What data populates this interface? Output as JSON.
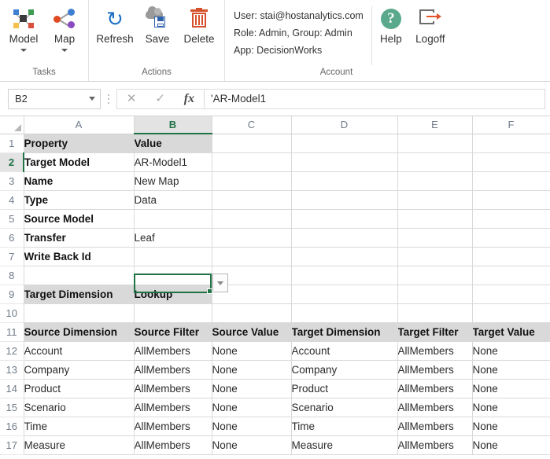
{
  "ribbon": {
    "groups": [
      {
        "label": "Tasks",
        "buttons": [
          {
            "label": "Model",
            "icon": "model-icon",
            "has_caret": true
          },
          {
            "label": "Map",
            "icon": "map-icon",
            "has_caret": true
          }
        ]
      },
      {
        "label": "Actions",
        "buttons": [
          {
            "label": "Refresh",
            "icon": "refresh-icon",
            "has_caret": false
          },
          {
            "label": "Save",
            "icon": "save-cloud-icon",
            "has_caret": false
          },
          {
            "label": "Delete",
            "icon": "trash-icon",
            "has_caret": false
          }
        ]
      },
      {
        "label": "Account",
        "info": [
          "User: stai@hostanalytics.com",
          "Role: Admin, Group: Admin",
          "App: DecisionWorks"
        ],
        "buttons": [
          {
            "label": "Help",
            "icon": "help-icon",
            "has_caret": false
          },
          {
            "label": "Logoff",
            "icon": "logoff-icon",
            "has_caret": false
          }
        ]
      }
    ]
  },
  "formula_bar": {
    "name_box_value": "B2",
    "cancel_icon": "✕",
    "accept_icon": "✓",
    "function_icon": "fx",
    "formula_value": "'AR-Model1"
  },
  "sheet": {
    "columns": [
      "A",
      "B",
      "C",
      "D",
      "E",
      "F"
    ],
    "selected_column": "B",
    "selected_row": "2",
    "selected_cell_value": "AR-Model1",
    "rows": [
      {
        "num": "1",
        "style": "header",
        "cells": [
          "Property",
          "Value",
          "",
          "",
          "",
          ""
        ]
      },
      {
        "num": "2",
        "style": "bold",
        "cells": [
          "Target Model",
          "AR-Model1",
          "",
          "",
          "",
          ""
        ]
      },
      {
        "num": "3",
        "style": "bold",
        "cells": [
          "Name",
          "New Map",
          "",
          "",
          "",
          ""
        ]
      },
      {
        "num": "4",
        "style": "bold",
        "cells": [
          "Type",
          "Data",
          "",
          "",
          "",
          ""
        ]
      },
      {
        "num": "5",
        "style": "bold",
        "cells": [
          "Source Model",
          "",
          "",
          "",
          "",
          ""
        ]
      },
      {
        "num": "6",
        "style": "bold",
        "cells": [
          "Transfer",
          "Leaf",
          "",
          "",
          "",
          ""
        ]
      },
      {
        "num": "7",
        "style": "bold",
        "cells": [
          "Write Back Id",
          "",
          "",
          "",
          "",
          ""
        ]
      },
      {
        "num": "8",
        "style": "plain",
        "cells": [
          "",
          "",
          "",
          "",
          "",
          ""
        ]
      },
      {
        "num": "9",
        "style": "header",
        "cells": [
          "Target Dimension",
          "Lookup",
          "",
          "",
          "",
          ""
        ]
      },
      {
        "num": "10",
        "style": "plain",
        "cells": [
          "",
          "",
          "",
          "",
          "",
          ""
        ]
      },
      {
        "num": "11",
        "style": "header",
        "cells": [
          "Source Dimension",
          "Source Filter",
          "Source Value",
          "Target Dimension",
          "Target Filter",
          "Target Value"
        ]
      },
      {
        "num": "12",
        "style": "plain",
        "cells": [
          "Account",
          "AllMembers",
          "None",
          "Account",
          "AllMembers",
          "None"
        ]
      },
      {
        "num": "13",
        "style": "plain",
        "cells": [
          "Company",
          "AllMembers",
          "None",
          "Company",
          "AllMembers",
          "None"
        ]
      },
      {
        "num": "14",
        "style": "plain",
        "cells": [
          "Product",
          "AllMembers",
          "None",
          "Product",
          "AllMembers",
          "None"
        ]
      },
      {
        "num": "15",
        "style": "plain",
        "cells": [
          "Scenario",
          "AllMembers",
          "None",
          "Scenario",
          "AllMembers",
          "None"
        ]
      },
      {
        "num": "16",
        "style": "plain",
        "cells": [
          "Time",
          "AllMembers",
          "None",
          "Time",
          "AllMembers",
          "None"
        ]
      },
      {
        "num": "17",
        "style": "plain",
        "cells": [
          "Measure",
          "AllMembers",
          "None",
          "Measure",
          "AllMembers",
          "None"
        ]
      }
    ]
  },
  "colors": {
    "excel_green": "#217346",
    "header_fill": "#d9d9d9",
    "refresh_blue": "#1f72c4",
    "delete_orange": "#d4502a",
    "help_green": "#5aa98c",
    "logoff_orange": "#e2552a"
  }
}
